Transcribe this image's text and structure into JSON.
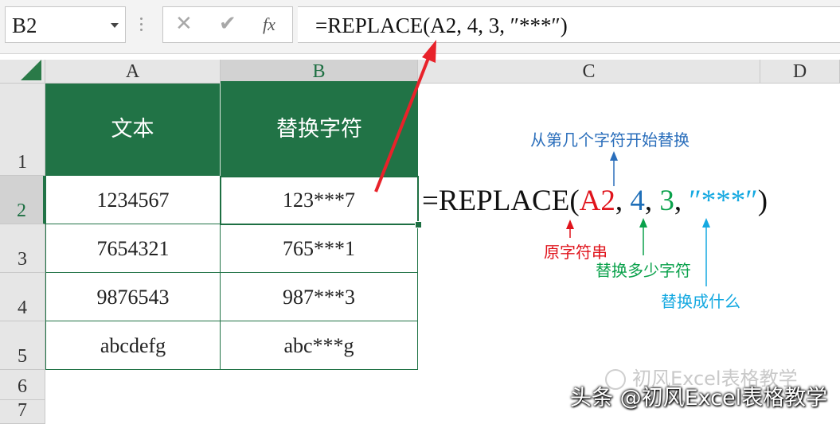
{
  "name_box": {
    "value": "B2"
  },
  "formula_bar": {
    "cancel_icon": "✕",
    "enter_icon": "✔",
    "fx_label": "fx",
    "formula": "=REPLACE(A2, 4, 3, ″***″)"
  },
  "columns": [
    "A",
    "B",
    "C",
    "D"
  ],
  "rows": [
    "1",
    "2",
    "3",
    "4",
    "5",
    "6",
    "7"
  ],
  "table": {
    "headers": [
      "文本",
      "替换字符"
    ],
    "rows": [
      [
        "1234567",
        "123***7"
      ],
      [
        "7654321",
        "765***1"
      ],
      [
        "9876543",
        "987***3"
      ],
      [
        "abcdefg",
        "abc***g"
      ]
    ]
  },
  "annotation": {
    "formula_parts": {
      "prefix": "=REPLACE(",
      "arg1": "A2",
      "sep1": ", ",
      "arg2": "4",
      "sep2": ", ",
      "arg3": "3",
      "sep3": ", ",
      "arg4": "″***″",
      "suffix": ")"
    },
    "labels": {
      "start_pos": "从第几个字符开始替换",
      "original": "原字符串",
      "count": "替换多少字符",
      "replace_with": "替换成什么"
    }
  },
  "watermarks": {
    "faint": "初风Excel表格教学",
    "main": "头条 @初风Excel表格教学"
  },
  "colors": {
    "header_green": "#217346",
    "arrow_red": "#e8222a",
    "red": "#e0141c",
    "blue": "#1f6fb8",
    "green": "#0aa14b",
    "cyan": "#15a9e1"
  }
}
